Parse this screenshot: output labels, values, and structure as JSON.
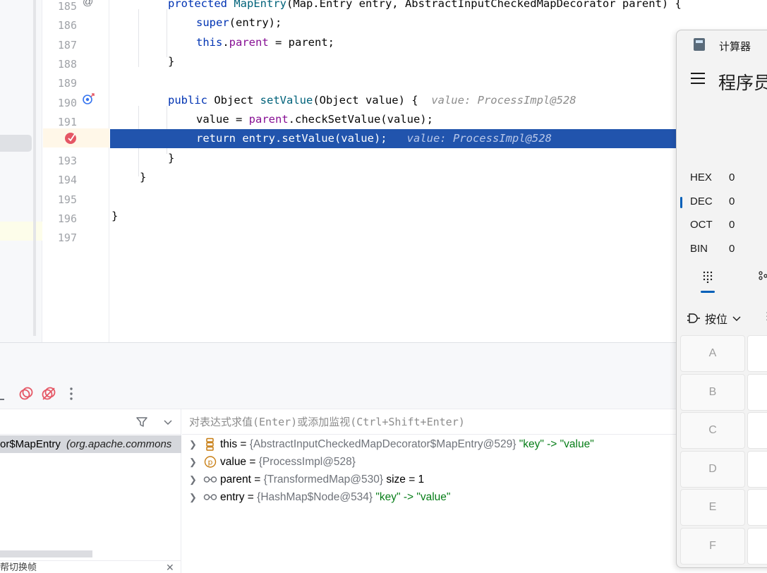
{
  "editor": {
    "lines": [
      {
        "num": "185",
        "tokens": [
          [
            "kw",
            "protected "
          ],
          [
            "fn",
            "MapEntry"
          ],
          [
            "",
            "(Map.Entry entry, AbstractInputCheckedMapDecorator parent) {"
          ]
        ]
      },
      {
        "num": "186",
        "tokens": [
          [
            "kw",
            "super"
          ],
          [
            "",
            "(entry);"
          ]
        ]
      },
      {
        "num": "187",
        "tokens": [
          [
            "kw",
            "this"
          ],
          [
            "",
            "."
          ],
          [
            "fld",
            "parent"
          ],
          [
            "",
            " = parent;"
          ]
        ]
      },
      {
        "num": "188",
        "tokens": [
          [
            "",
            "}"
          ]
        ]
      },
      {
        "num": "189",
        "tokens": []
      },
      {
        "num": "190",
        "tokens": [
          [
            "kw",
            "public "
          ],
          [
            "",
            "Object "
          ],
          [
            "fn",
            "setValue"
          ],
          [
            "",
            "(Object value) {  "
          ],
          [
            "hint",
            "value: ProcessImpl@528"
          ]
        ]
      },
      {
        "num": "191",
        "tokens": [
          [
            "",
            "value = "
          ],
          [
            "fld",
            "parent"
          ],
          [
            "",
            ".checkSetValue(value);"
          ]
        ]
      },
      {
        "num": "192",
        "tokens": [
          [
            "kw",
            "return "
          ],
          [
            "",
            "entry.setValue(value);   "
          ],
          [
            "hint",
            "value: ProcessImpl@528"
          ]
        ]
      },
      {
        "num": "193",
        "tokens": [
          [
            "",
            "}"
          ]
        ]
      },
      {
        "num": "194",
        "tokens": [
          [
            "",
            "}"
          ]
        ]
      },
      {
        "num": "195",
        "tokens": []
      },
      {
        "num": "196",
        "tokens": [
          [
            "",
            "}"
          ]
        ]
      },
      {
        "num": "197",
        "tokens": []
      }
    ]
  },
  "debugger": {
    "frame_label": "or$MapEntry",
    "frame_pkg": "(org.apache.commons",
    "frames_footer": "帮切换帧",
    "watch_placeholder": "对表达式求值(Enter)或添加监视(Ctrl+Shift+Enter)",
    "variables": [
      {
        "name": "this",
        "eq": " = ",
        "ref": "{AbstractInputCheckedMapDecorator$MapEntry@529}",
        "extra": " \"key\" -> \"value\"",
        "extra_color": "string",
        "icon": "field-list"
      },
      {
        "name": "value",
        "eq": " = ",
        "ref": "{ProcessImpl@528}",
        "extra": "",
        "extra_color": "",
        "icon": "param"
      },
      {
        "name": "parent",
        "eq": " = ",
        "ref": "{TransformedMap@530}",
        "extra": "  size = 1",
        "extra_color": "plain",
        "icon": "glasses"
      },
      {
        "name": "entry",
        "eq": " = ",
        "ref": "{HashMap$Node@534}",
        "extra": " \"key\" -> \"value\"",
        "extra_color": "string",
        "icon": "glasses"
      }
    ]
  },
  "calculator": {
    "title": "计算器",
    "mode": "程序员",
    "radix": [
      {
        "name": "HEX",
        "value": "0"
      },
      {
        "name": "DEC",
        "value": "0"
      },
      {
        "name": "OCT",
        "value": "0"
      },
      {
        "name": "BIN",
        "value": "0"
      }
    ],
    "bitwise_label": "按位",
    "keys": [
      "A",
      "B",
      "C",
      "D",
      "E",
      "F"
    ]
  },
  "colors": {
    "accent": "#005fb8",
    "exec_line": "#2154ad",
    "breakpoint": "#e55765"
  }
}
